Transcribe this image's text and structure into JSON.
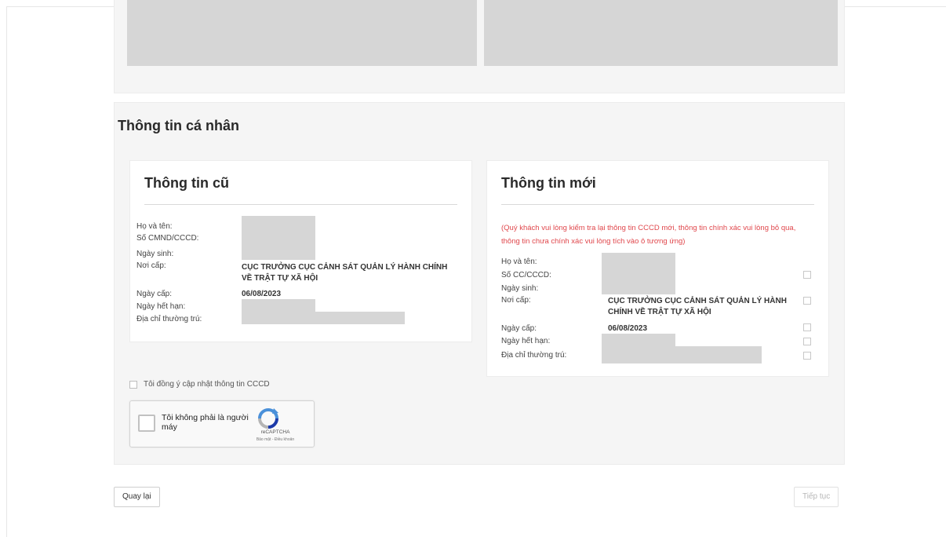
{
  "section_title": "Thông tin cá nhân",
  "old_card": {
    "title": "Thông tin cũ",
    "labels": {
      "full_name": "Họ và tên:",
      "id_number": "Số CMND/CCCD:",
      "dob": "Ngày sinh:",
      "issued_by": "Nơi cấp:",
      "issue_date": "Ngày cấp:",
      "expiry_date": "Ngày hết hạn:",
      "address": "Địa chỉ thường trú:"
    },
    "values": {
      "issued_by": "CỤC TRƯỞNG CỤC CẢNH SÁT QUẢN LÝ HÀNH CHÍNH VỀ TRẬT TỰ XÃ HỘI",
      "issue_date": "06/08/2023"
    }
  },
  "new_card": {
    "title": "Thông tin mới",
    "notice": "(Quý khách vui lòng kiểm tra lại thông tin CCCD mới, thông tin chính xác vui lòng bỏ qua, thông tin chưa chính xác vui lòng tích vào ô tương ứng)",
    "labels": {
      "full_name": "Họ và tên:",
      "id_number": "Số CC/CCCD:",
      "dob": "Ngày sinh:",
      "issued_by": "Nơi cấp:",
      "issue_date": "Ngày cấp:",
      "expiry_date": "Ngày hết hạn:",
      "address": "Địa chỉ thường trú:"
    },
    "values": {
      "issued_by": "CỤC TRƯỞNG CỤC CẢNH SÁT QUẢN LÝ HÀNH CHÍNH VỀ TRẬT TỰ XÃ HỘI",
      "issue_date": "06/08/2023"
    }
  },
  "consent_label": "Tôi đồng ý cập nhật thông tin CCCD",
  "captcha": {
    "text": "Tôi không phải là người máy",
    "brand": "reCAPTCHA",
    "terms": "Bảo mật - Điều khoản",
    "logo_icon": "recaptcha-logo-icon"
  },
  "buttons": {
    "back": "Quay lại",
    "next": "Tiếp tục"
  },
  "colors": {
    "notice_red": "#e0474c",
    "panel_bg": "#f5f5f5",
    "redaction": "#d6d6d6"
  }
}
